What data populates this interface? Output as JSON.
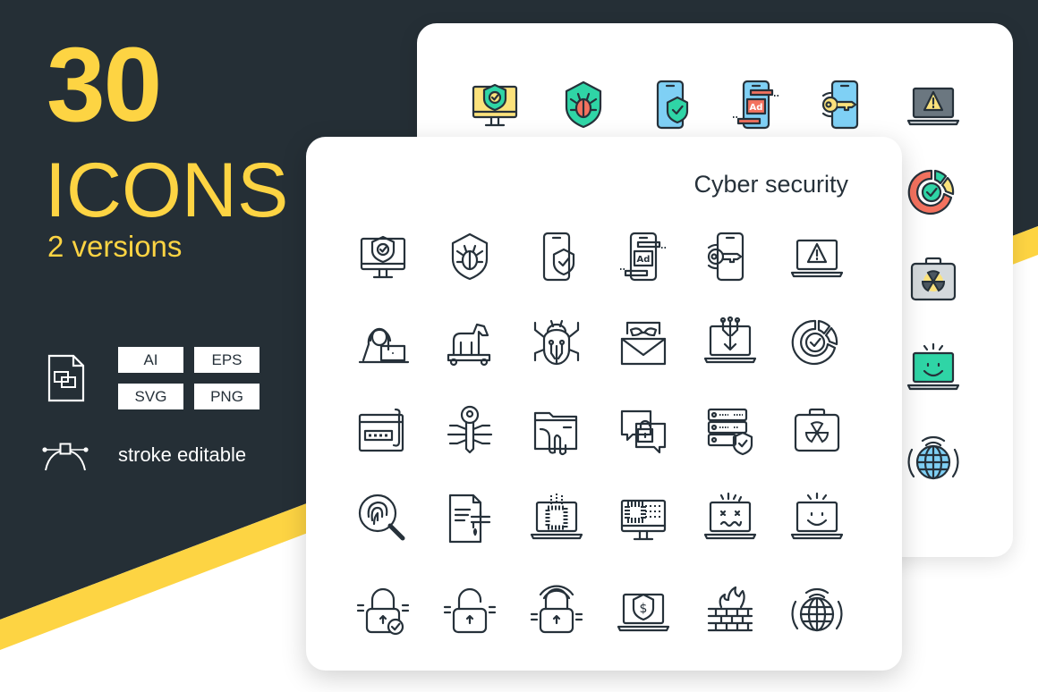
{
  "colors": {
    "dark_bg": "#252f36",
    "accent_yellow": "#fdd443",
    "stroke": "#26313a",
    "teal": "#2fd5a6",
    "light_yellow": "#fbe27c",
    "red": "#f3725f",
    "blue": "#7fd0f5",
    "gray": "#d4d9dc",
    "card_bg": "#ffffff"
  },
  "hero": {
    "count": "30",
    "word": "ICONS",
    "versions": "2 versions"
  },
  "formats": {
    "file_icon": "file-vector-icon",
    "badges": [
      "AI",
      "EPS",
      "SVG",
      "PNG"
    ]
  },
  "stroke": {
    "icon": "bezier-pen-icon",
    "label": "stroke editable"
  },
  "front_card": {
    "title": "Cyber security",
    "style": "outline",
    "icons": [
      "monitor-shield-check-icon",
      "shield-bug-icon",
      "phone-shield-check-icon",
      "phone-ad-icon",
      "phone-key-icon",
      "laptop-warning-icon",
      "hacker-laptop-icon",
      "trojan-horse-icon",
      "circuit-bug-icon",
      "spam-mail-mask-icon",
      "laptop-download-circuit-icon",
      "target-chart-check-icon",
      "phishing-password-icon",
      "circuit-key-icon",
      "folder-leak-icon",
      "chat-unlock-icon",
      "server-shield-icon",
      "case-radiation-icon",
      "fingerprint-search-icon",
      "document-leak-tap-icon",
      "laptop-qr-icon",
      "monitor-data-noise-icon",
      "laptop-broken-face-icon",
      "laptop-smile-icon",
      "padlock-check-icon",
      "padlock-open-icon",
      "padlock-wireless-icon",
      "laptop-shield-dollar-icon",
      "firewall-icon",
      "globe-signal-icon"
    ]
  },
  "back_card": {
    "style": "color",
    "visible_icons": [
      "monitor-shield-check-icon",
      "shield-bug-icon",
      "phone-shield-check-icon",
      "phone-ad-icon",
      "phone-key-icon",
      "laptop-warning-icon",
      "target-chart-check-icon",
      "case-radiation-icon",
      "laptop-smile-icon",
      "globe-signal-icon"
    ]
  }
}
